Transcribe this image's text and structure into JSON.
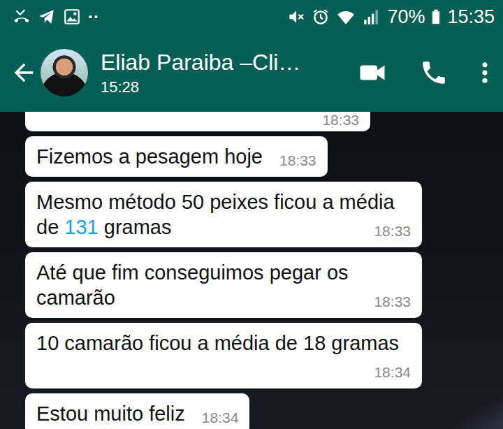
{
  "status_bar": {
    "notice": "··",
    "battery": "70%",
    "time": "15:35"
  },
  "header": {
    "title": "Eliab Paraiba –Cli…",
    "subtitle": "15:28"
  },
  "messages": [
    {
      "parts": [],
      "time": "18:33"
    },
    {
      "parts": [
        {
          "text": "Fizemos a pesagem hoje",
          "link": false
        }
      ],
      "time": "18:33"
    },
    {
      "parts": [
        {
          "text": "Mesmo método 50 peixes ficou a média de ",
          "link": false
        },
        {
          "text": "131",
          "link": true
        },
        {
          "text": " gramas",
          "link": false
        }
      ],
      "time": "18:33"
    },
    {
      "parts": [
        {
          "text": "Até que fim conseguimos pegar os camarão",
          "link": false
        }
      ],
      "time": "18:33"
    },
    {
      "parts": [
        {
          "text": "10 camarão ficou a média de 18 gramas",
          "link": false
        }
      ],
      "time": "18:34"
    },
    {
      "parts": [
        {
          "text": "Estou muito feliz",
          "link": false
        }
      ],
      "time": "18:34"
    }
  ]
}
